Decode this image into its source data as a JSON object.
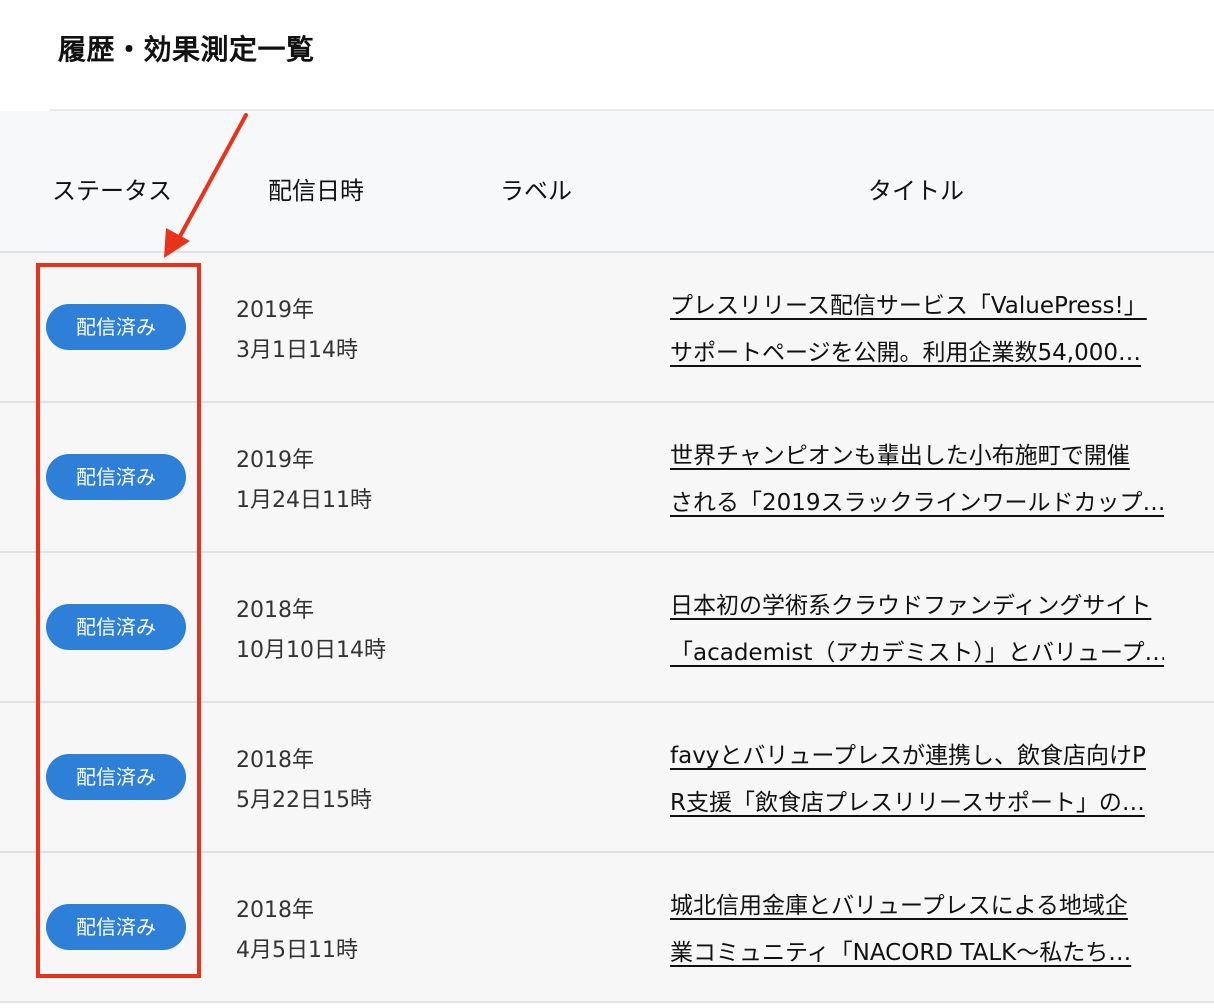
{
  "page": {
    "title": "履歴・効果測定一覧"
  },
  "table": {
    "headers": {
      "status": "ステータス",
      "date": "配信日時",
      "label": "ラベル",
      "title": "タイトル"
    },
    "rows": [
      {
        "status": "配信済み",
        "date_year": "2019年",
        "date_time": "3月1日14時",
        "label": "",
        "title_line1": "プレスリリース配信サービス「ValuePress!」",
        "title_line2": "サポートページを公開。利用企業数54,000…"
      },
      {
        "status": "配信済み",
        "date_year": "2019年",
        "date_time": "1月24日11時",
        "label": "",
        "title_line1": "世界チャンピオンも輩出した小布施町で開催",
        "title_line2": "される「2019スラックラインワールドカップ…"
      },
      {
        "status": "配信済み",
        "date_year": "2018年",
        "date_time": "10月10日14時",
        "label": "",
        "title_line1": "日本初の学術系クラウドファンディングサイト",
        "title_line2": "「academist（アカデミスト）」とバリュープ…"
      },
      {
        "status": "配信済み",
        "date_year": "2018年",
        "date_time": "5月22日15時",
        "label": "",
        "title_line1": "favyとバリュープレスが連携し、飲食店向けP",
        "title_line2": "R支援「飲食店プレスリリースサポート」の…"
      },
      {
        "status": "配信済み",
        "date_year": "2018年",
        "date_time": "4月5日11時",
        "label": "",
        "title_line1": "城北信用金庫とバリュープレスによる地域企",
        "title_line2": "業コミュニティ「NACORD TALK～私たち…"
      }
    ]
  },
  "colors": {
    "status_badge": "#2d7fd7",
    "annotation": "#e8321a",
    "header_bg": "#f7f8fa",
    "row_bg": "#f7f7f8"
  }
}
